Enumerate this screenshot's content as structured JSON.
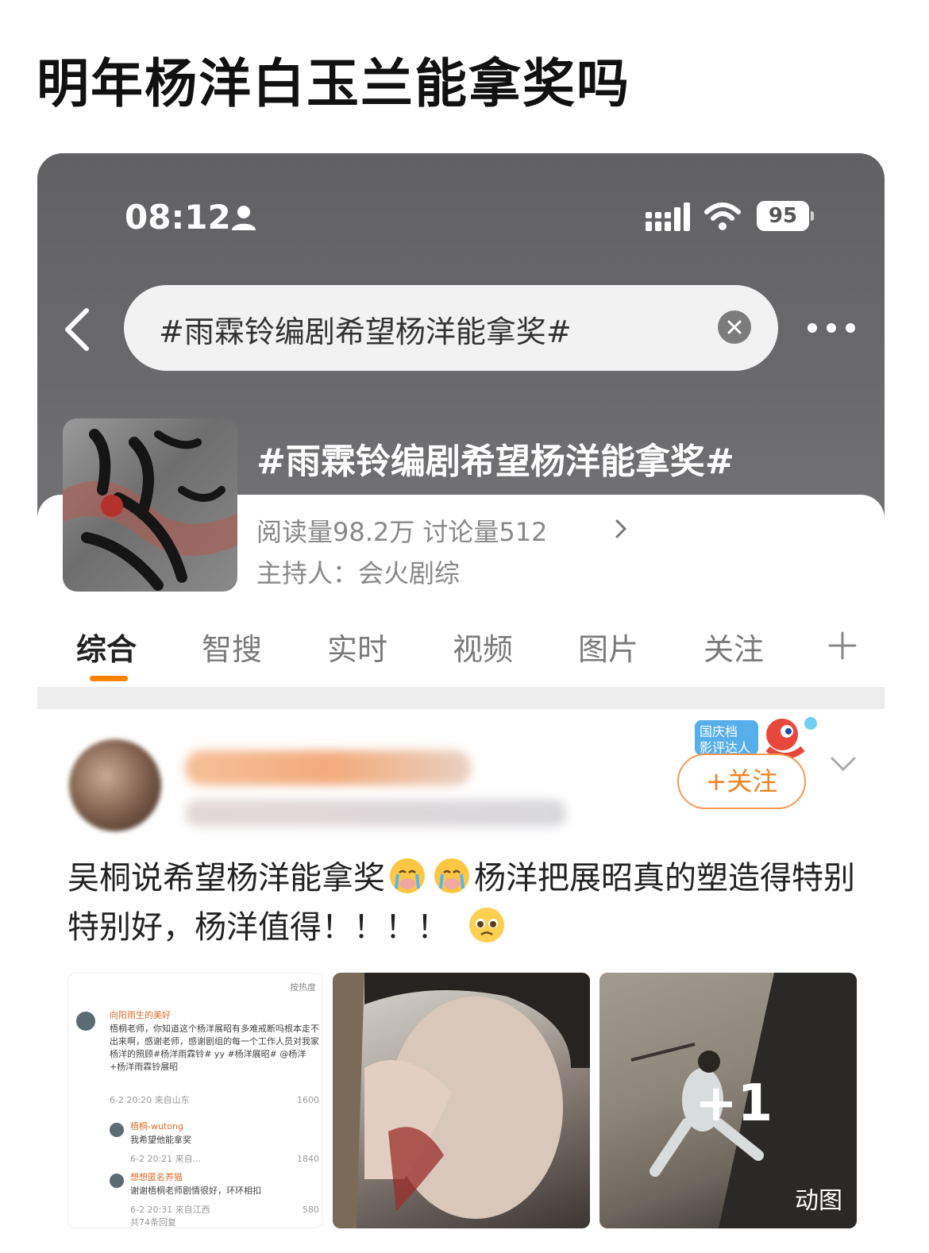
{
  "post": {
    "title": "明年杨洋白玉兰能拿奖吗"
  },
  "status_bar": {
    "time": "08:12",
    "battery": "95"
  },
  "search": {
    "query": "#雨霖铃编剧希望杨洋能拿奖#"
  },
  "topic": {
    "title": "#雨霖铃编剧希望杨洋能拿奖#",
    "stats": "阅读量98.2万  讨论量512",
    "host": "主持人：会火剧综"
  },
  "tabs": [
    {
      "label": "综合"
    },
    {
      "label": "智搜"
    },
    {
      "label": "实时"
    },
    {
      "label": "视频"
    },
    {
      "label": "图片"
    },
    {
      "label": "关注"
    }
  ],
  "weibo_post": {
    "follow_label": "+关注",
    "badge_text": "国庆档影评达人",
    "text_part1": "吴桐说希望杨洋能拿奖",
    "text_part2": "杨洋把展昭真的塑造得特别特别好，杨洋值得！！！！",
    "emoji_crying": "crying-face-emoji",
    "emoji_pleading": "pleading-face-emoji"
  },
  "images": {
    "more_count": "+1",
    "gif_label": "动图",
    "screenshot": {
      "sort_label": "按热度",
      "c1_name": "向阳雨生的美好",
      "c1_text": "梧桐老师，你知道这个杨洋展昭有多难戒断吗根本走不出来啊，感谢老师，感谢剧组的每一个工作人员对我家杨洋的照顾#杨洋雨霖铃# yy #杨洋展昭# @杨洋 +杨洋雨霖铃展昭",
      "c1_meta": "6-2 20:20 来自山东",
      "c1_likes": "1600",
      "c2_name": "梧桐-wutong",
      "c2_text": "我希望他能拿奖",
      "c2_meta": "6-2 20:21 来自...",
      "c2_likes": "1840",
      "c3_name": "想想匿名养猫",
      "c3_text": "谢谢梧桐老师剧情很好，环环相扣",
      "c3_meta": "6-2 20:31 来自江西",
      "c3_likes": "580",
      "c3_replies": "共74条回复"
    }
  },
  "colors": {
    "accent": "#ff8200",
    "header_bg": "#666668"
  }
}
